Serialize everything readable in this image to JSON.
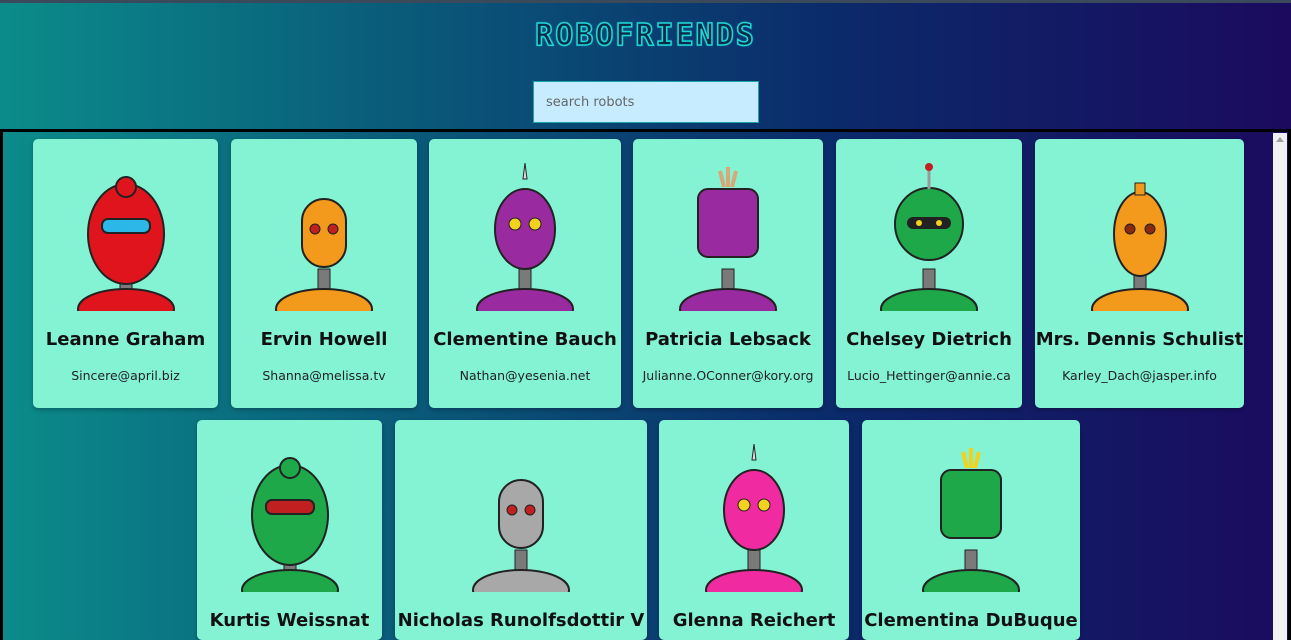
{
  "app": {
    "title": "ROBOFRIENDS"
  },
  "search": {
    "placeholder": "search robots"
  },
  "robots": [
    {
      "name": "Leanne Graham",
      "email": "Sincere@april.biz",
      "color": "#e0141c",
      "accent": "#2bb8e8"
    },
    {
      "name": "Ervin Howell",
      "email": "Shanna@melissa.tv",
      "color": "#f39a1c",
      "accent": "#c02020"
    },
    {
      "name": "Clementine Bauch",
      "email": "Nathan@yesenia.net",
      "color": "#9a2aa0",
      "accent": "#f2d21c"
    },
    {
      "name": "Patricia Lebsack",
      "email": "Julianne.OConner@kory.org",
      "color": "#9a2aa0",
      "accent": "#d8a878"
    },
    {
      "name": "Chelsey Dietrich",
      "email": "Lucio_Hettinger@annie.ca",
      "color": "#1ea84a",
      "accent": "#f2d21c"
    },
    {
      "name": "Mrs. Dennis Schulist",
      "email": "Karley_Dach@jasper.info",
      "color": "#f39a1c",
      "accent": "#8a2a10"
    },
    {
      "name": "Kurtis Weissnat",
      "email": "",
      "color": "#1ea84a",
      "accent": "#c02020"
    },
    {
      "name": "Nicholas Runolfsdottir V",
      "email": "",
      "color": "#a8a8a8",
      "accent": "#c02020"
    },
    {
      "name": "Glenna Reichert",
      "email": "",
      "color": "#f02aa0",
      "accent": "#f2d21c"
    },
    {
      "name": "Clementina DuBuque",
      "email": "",
      "color": "#1ea84a",
      "accent": "#f2d21c"
    }
  ]
}
